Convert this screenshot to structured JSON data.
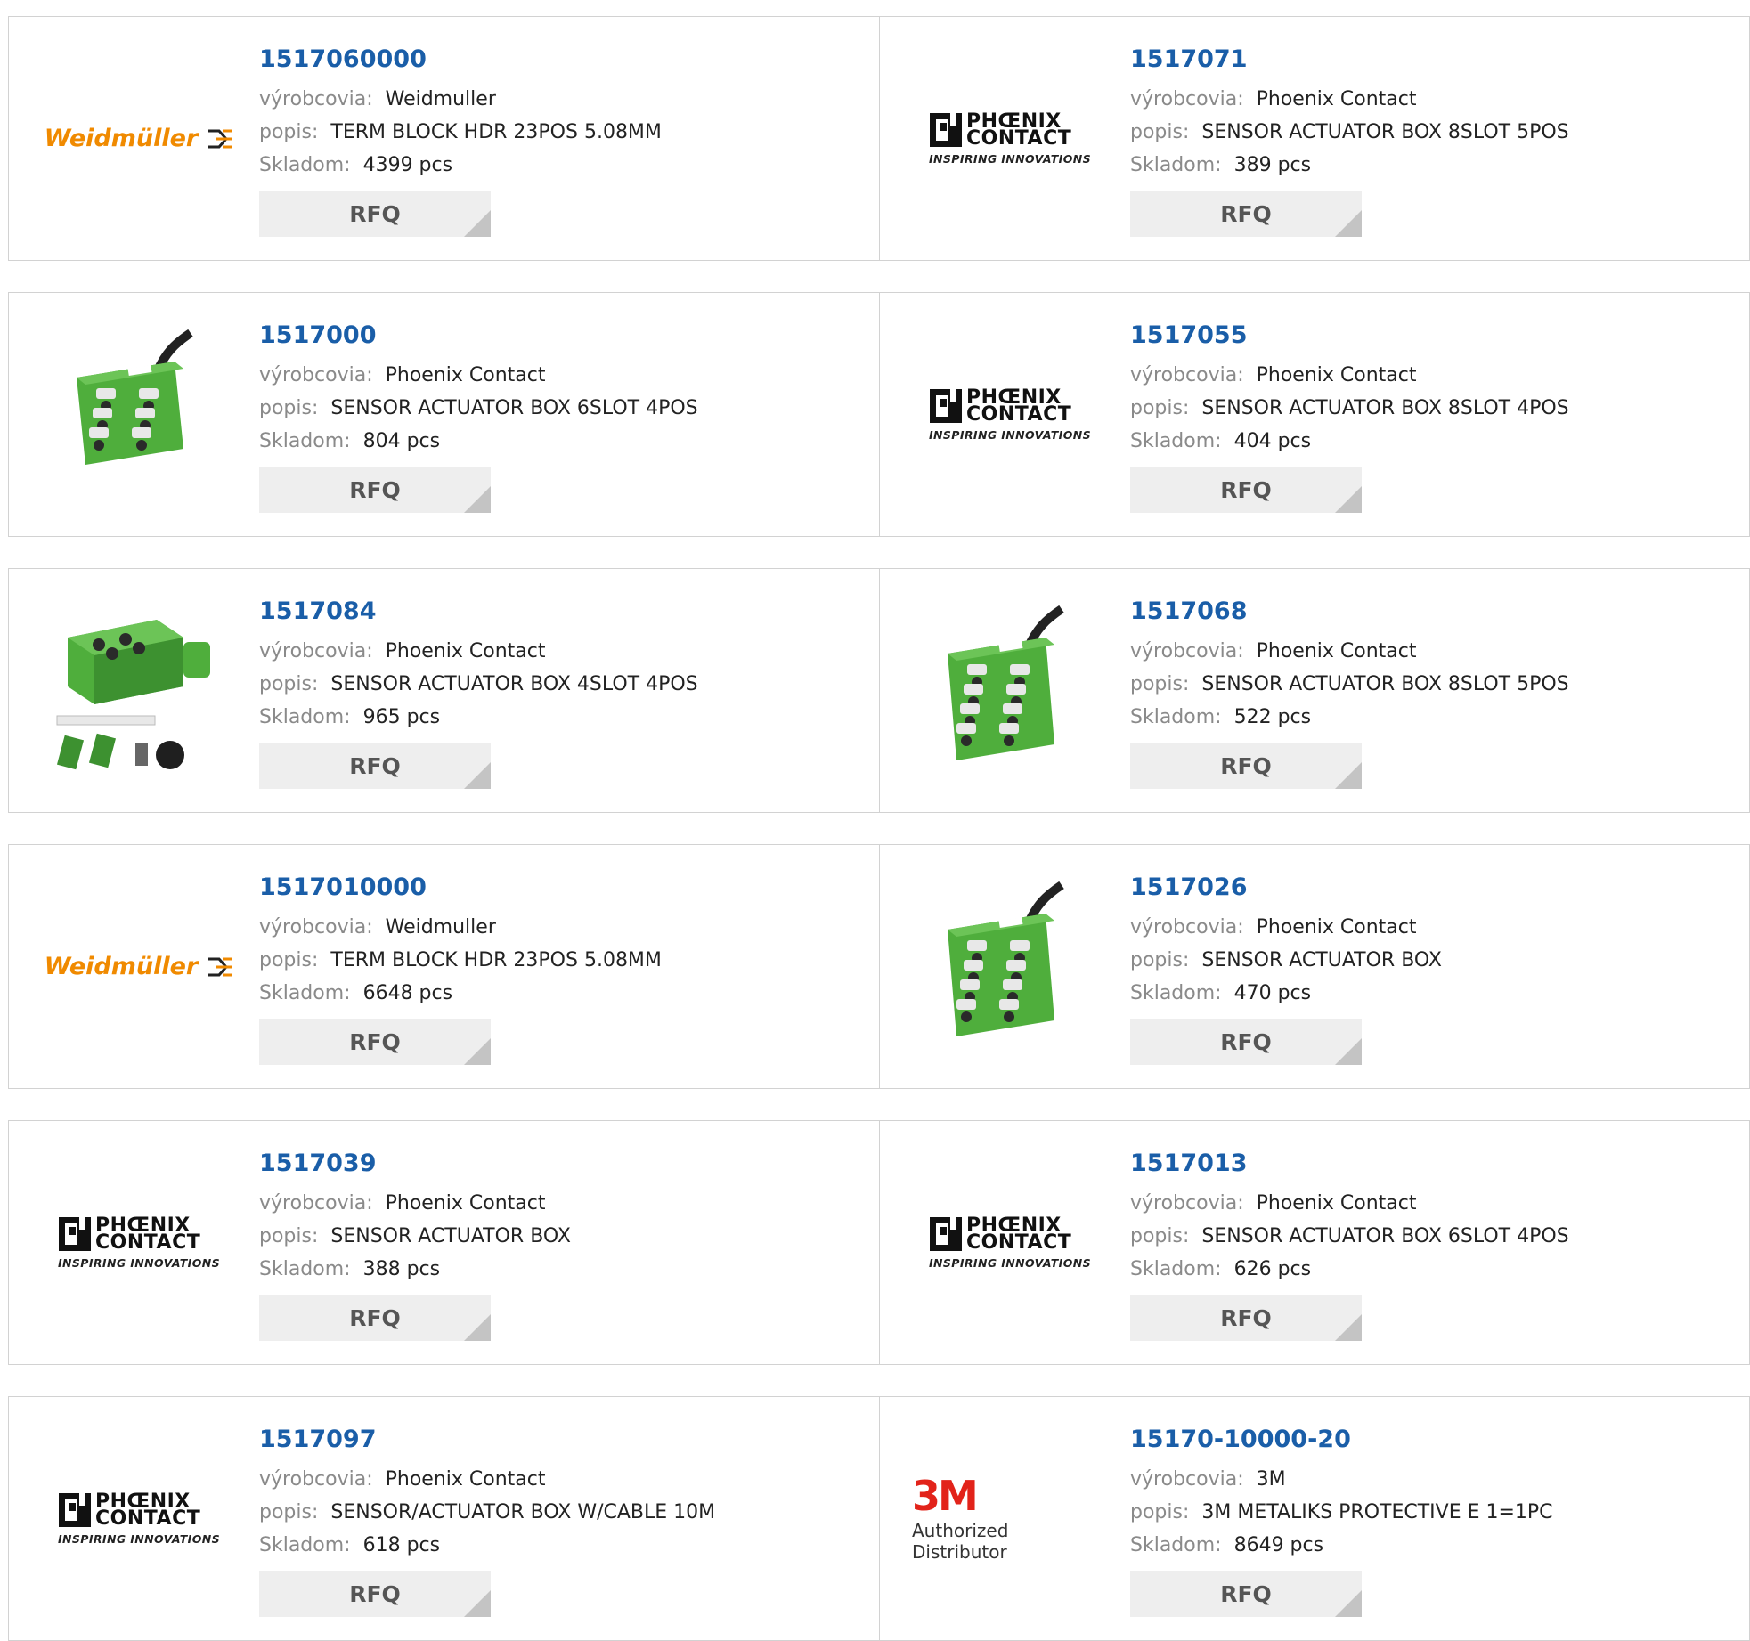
{
  "labels": {
    "manufacturer": "výrobcovia:",
    "description": "popis:",
    "stock": "Skladom:",
    "rfq": "RFQ"
  },
  "logos": {
    "weidmuller": "Weidmüller",
    "phoenix_line1": "PHŒNIX",
    "phoenix_line2": "CONTACT",
    "phoenix_tagline": "INSPIRING INNOVATIONS",
    "threem": "3M",
    "threem_sub": "Authorized Distributor"
  },
  "colors": {
    "part_number": "#1a5ea8",
    "weidmuller_orange": "#f08a00",
    "product_green": "#4fae3c",
    "threem_red": "#e2231a"
  },
  "products": [
    {
      "part_number": "1517060000",
      "manufacturer": "Weidmuller",
      "description": "TERM BLOCK HDR 23POS 5.08MM",
      "stock": "4399 pcs",
      "image": "weidmuller-logo"
    },
    {
      "part_number": "1517071",
      "manufacturer": "Phoenix Contact",
      "description": "SENSOR ACTUATOR BOX 8SLOT 5POS",
      "stock": "389 pcs",
      "image": "phoenix-contact-logo"
    },
    {
      "part_number": "1517000",
      "manufacturer": "Phoenix Contact",
      "description": "SENSOR ACTUATOR BOX 6SLOT 4POS",
      "stock": "804 pcs",
      "image": "sensor-box-6slot"
    },
    {
      "part_number": "1517055",
      "manufacturer": "Phoenix Contact",
      "description": "SENSOR ACTUATOR BOX 8SLOT 4POS",
      "stock": "404 pcs",
      "image": "phoenix-contact-logo"
    },
    {
      "part_number": "1517084",
      "manufacturer": "Phoenix Contact",
      "description": "SENSOR ACTUATOR BOX 4SLOT 4POS",
      "stock": "965 pcs",
      "image": "sensor-box-4slot-kit"
    },
    {
      "part_number": "1517068",
      "manufacturer": "Phoenix Contact",
      "description": "SENSOR ACTUATOR BOX 8SLOT 5POS",
      "stock": "522 pcs",
      "image": "sensor-box-8slot"
    },
    {
      "part_number": "1517010000",
      "manufacturer": "Weidmuller",
      "description": "TERM BLOCK HDR 23POS 5.08MM",
      "stock": "6648 pcs",
      "image": "weidmuller-logo"
    },
    {
      "part_number": "1517026",
      "manufacturer": "Phoenix Contact",
      "description": "SENSOR ACTUATOR BOX",
      "stock": "470 pcs",
      "image": "sensor-box-8slot"
    },
    {
      "part_number": "1517039",
      "manufacturer": "Phoenix Contact",
      "description": "SENSOR ACTUATOR BOX",
      "stock": "388 pcs",
      "image": "phoenix-contact-logo"
    },
    {
      "part_number": "1517013",
      "manufacturer": "Phoenix Contact",
      "description": "SENSOR ACTUATOR BOX 6SLOT 4POS",
      "stock": "626 pcs",
      "image": "phoenix-contact-logo"
    },
    {
      "part_number": "1517097",
      "manufacturer": "Phoenix Contact",
      "description": "SENSOR/ACTUATOR BOX W/CABLE 10M",
      "stock": "618 pcs",
      "image": "phoenix-contact-logo"
    },
    {
      "part_number": "15170-10000-20",
      "manufacturer": "3M",
      "description": "3M METALIKS PROTECTIVE E 1=1PC",
      "stock": "8649 pcs",
      "image": "3m-logo"
    }
  ]
}
